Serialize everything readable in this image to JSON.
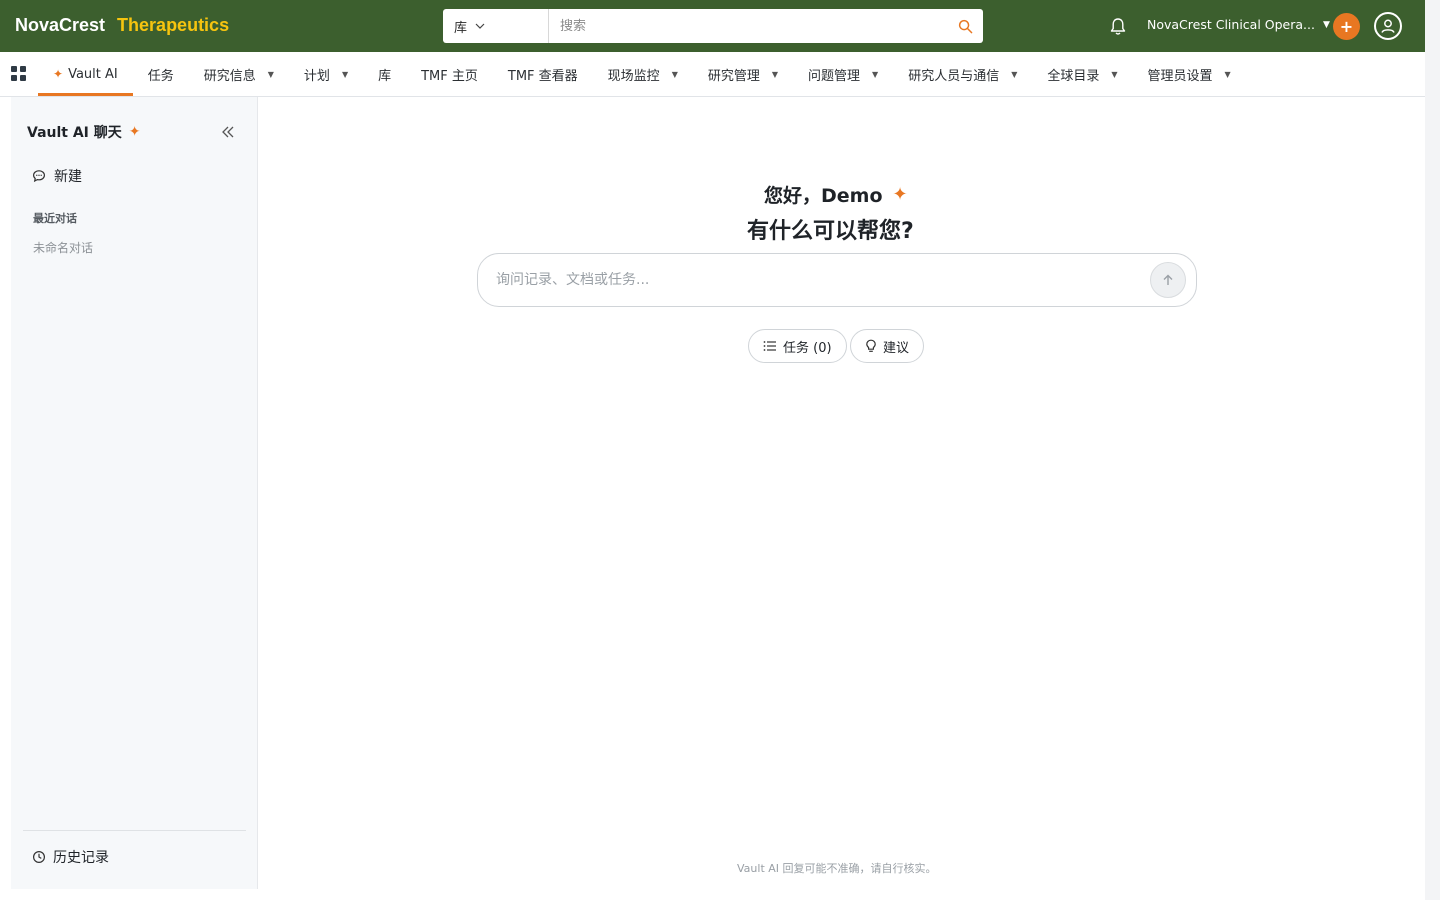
{
  "header": {
    "brand_primary": "NovaCrest",
    "brand_secondary": "Therapeutics",
    "search_scope": "库",
    "search_placeholder": "搜索",
    "org_name": "NovaCrest Clinical Opera...",
    "plus_label": "+",
    "colors": {
      "bar": "#3c5f2e",
      "accent": "#e87722",
      "brand_secondary": "#f6c40f"
    }
  },
  "nav": {
    "items": [
      {
        "label": "Vault AI",
        "active": true,
        "sparkle": true,
        "dropdown": false
      },
      {
        "label": "任务",
        "active": false,
        "dropdown": false
      },
      {
        "label": "研究信息",
        "active": false,
        "dropdown": true
      },
      {
        "label": "计划",
        "active": false,
        "dropdown": true
      },
      {
        "label": "库",
        "active": false,
        "dropdown": false
      },
      {
        "label": "TMF 主页",
        "active": false,
        "dropdown": false
      },
      {
        "label": "TMF 查看器",
        "active": false,
        "dropdown": false
      },
      {
        "label": "现场监控",
        "active": false,
        "dropdown": true
      },
      {
        "label": "研究管理",
        "active": false,
        "dropdown": true
      },
      {
        "label": "问题管理",
        "active": false,
        "dropdown": true
      },
      {
        "label": "研究人员与通信",
        "active": false,
        "dropdown": true
      },
      {
        "label": "全球目录",
        "active": false,
        "dropdown": true
      },
      {
        "label": "管理员设置",
        "active": false,
        "dropdown": true
      }
    ]
  },
  "sidebar": {
    "title": "Vault AI 聊天",
    "new_label": "新建",
    "recent_heading": "最近对话",
    "recent_items": [
      "未命名对话"
    ],
    "history_label": "历史记录"
  },
  "main": {
    "greeting": "您好，Demo",
    "prompt": "有什么可以帮您?",
    "input_placeholder": "询问记录、文档或任务...",
    "tasks_chip": "任务 (0)",
    "suggest_chip": "建议",
    "disclaimer": "Vault AI 回复可能不准确，请自行核实。"
  },
  "icons": {
    "apps": "grid-icon",
    "search": "search-icon",
    "bell": "bell-icon",
    "user": "user-circle-icon",
    "sparkle": "sparkle-icon",
    "collapse": "double-chevron-left-icon",
    "chat": "chat-bubble-icon",
    "history": "clock-icon",
    "send": "arrow-up-icon",
    "list": "list-icon",
    "lightbulb": "lightbulb-icon"
  }
}
